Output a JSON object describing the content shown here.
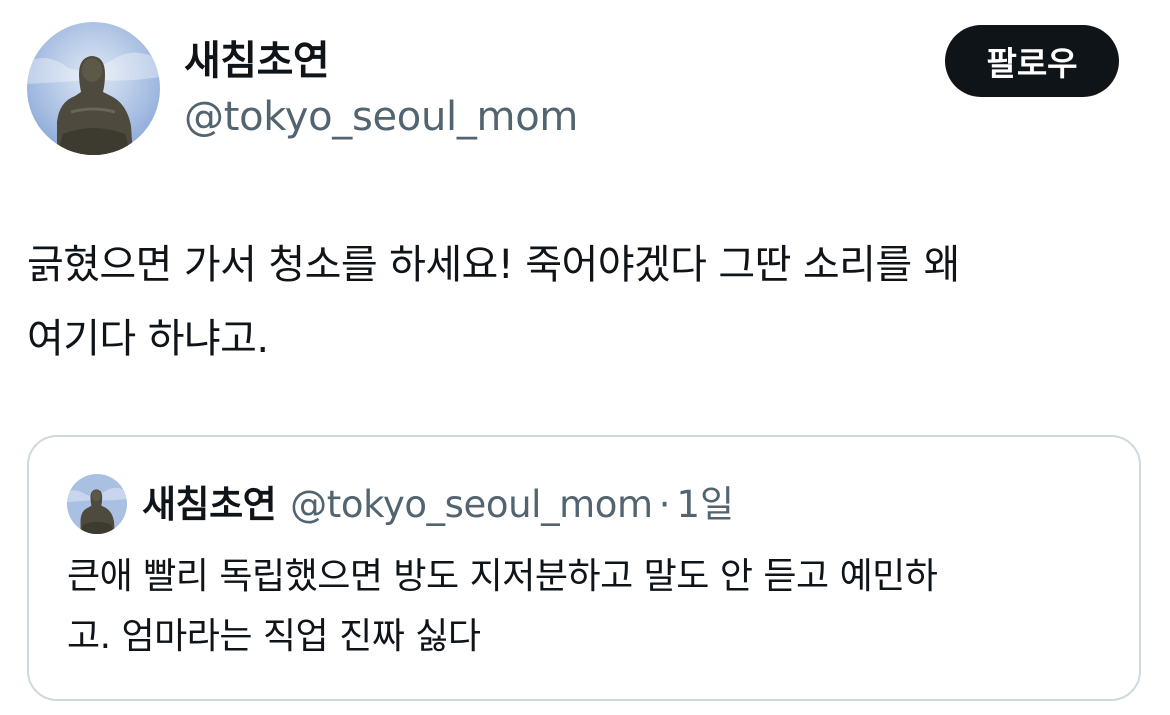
{
  "author": {
    "display_name": "새침초연",
    "handle": "@tokyo_seoul_mom",
    "avatar_icon": "buddha-statue-avatar"
  },
  "follow_button": {
    "label": "팔로우"
  },
  "tweet": {
    "text": "긁혔으면 가서 청소를 하세요! 죽어야겠다 그딴 소리를 왜\n여기다 하냐고."
  },
  "quoted_tweet": {
    "display_name": "새침초연",
    "handle": "@tokyo_seoul_mom",
    "separator": "·",
    "time": "1일",
    "text": "큰애 빨리 독립했으면 방도 지저분하고 말도 안 듣고 예민하\n고. 엄마라는 직업 진짜 싫다"
  },
  "colors": {
    "text_primary": "#0f1419",
    "text_secondary": "#536471",
    "button_bg": "#0f1419",
    "card_border": "#cfd9de"
  }
}
